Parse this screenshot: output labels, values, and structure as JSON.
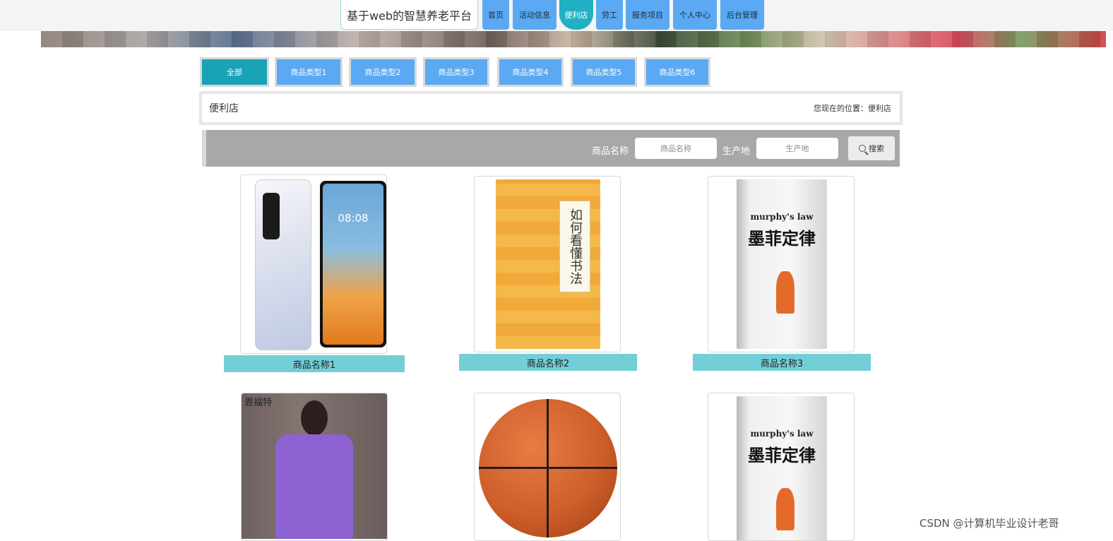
{
  "nav": {
    "brand": "基于web的智慧养老平台",
    "items": [
      "首页",
      "活动信息",
      "便利店",
      "劳工",
      "服务项目",
      "个人中心",
      "后台管理"
    ],
    "active_index": 2
  },
  "categories": [
    "全部",
    "商品类型1",
    "商品类型2",
    "商品类型3",
    "商品类型4",
    "商品类型5",
    "商品类型6"
  ],
  "breadcrumb": {
    "title": "便利店",
    "location": "您现在的位置：便利店"
  },
  "search": {
    "name_label": "商品名称",
    "name_placeholder": "商品名称",
    "origin_label": "生产地",
    "origin_placeholder": "生产地",
    "button_label": "搜索"
  },
  "products": [
    {
      "name": "商品名称1",
      "image_text": "08:08"
    },
    {
      "name": "商品名称2",
      "image_text": "如何看懂书法"
    },
    {
      "name": "商品名称3",
      "image_text_en": "murphy's law",
      "image_text": "墨菲定律"
    },
    {
      "image_text": "恩福特"
    },
    {},
    {
      "image_text_en": "murphy's law",
      "image_text": "墨菲定律"
    }
  ],
  "watermark": "CSDN @计算机毕业设计老哥",
  "colors": {
    "nav": "#5aa9f2",
    "active": "#20b0c3",
    "name_bar": "#72cfd8",
    "search_bar": "#a8a8a8"
  }
}
